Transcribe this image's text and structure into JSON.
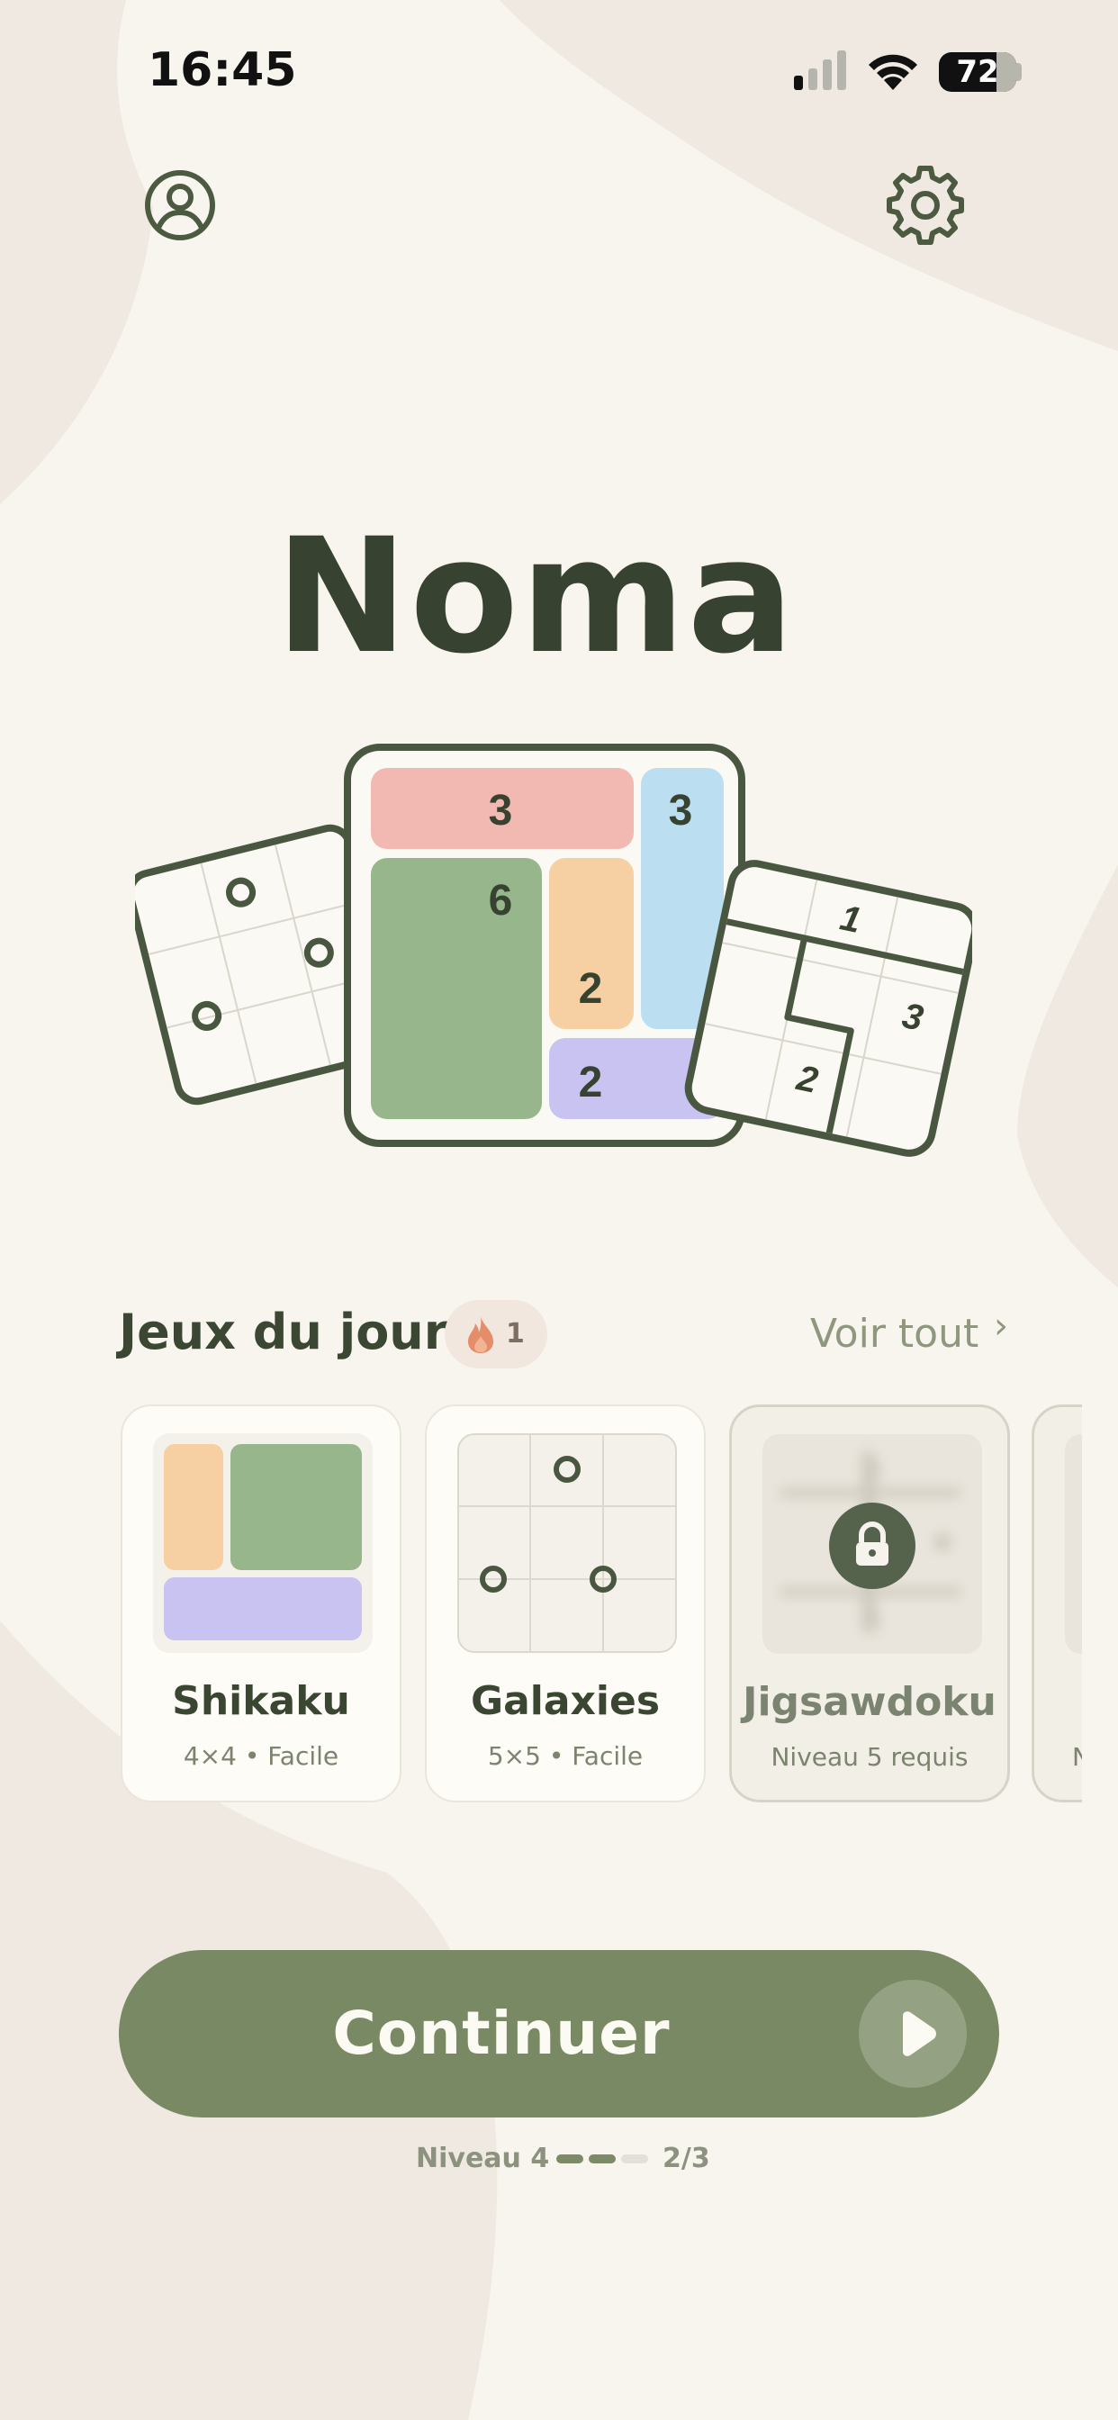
{
  "status_bar": {
    "time": "16:45",
    "battery": "72",
    "icons": [
      "cellular-signal-icon",
      "wifi-icon",
      "battery-icon"
    ]
  },
  "header": {
    "profile_icon": "user-circle-icon",
    "settings_icon": "gear-icon"
  },
  "app": {
    "title": "Noma"
  },
  "hero": {
    "center_board_numbers": [
      "3",
      "3",
      "6",
      "2",
      "2"
    ],
    "right_board_numbers": [
      "1",
      "3",
      "2"
    ]
  },
  "daily": {
    "title": "Jeux du jour",
    "streak_icon": "flame-icon",
    "streak_count": "1",
    "see_all": "Voir tout",
    "see_all_icon": "chevron-right-icon",
    "cards": [
      {
        "title": "Shikaku",
        "subtitle": "4×4 • Facile",
        "locked": false
      },
      {
        "title": "Galaxies",
        "subtitle": "5×5 • Facile",
        "locked": false
      },
      {
        "title": "Jigsawdoku",
        "subtitle": "Niveau 5 requis",
        "locked": true,
        "lock_icon": "lock-icon"
      },
      {
        "title": "",
        "subtitle": "N",
        "locked": true
      }
    ]
  },
  "continue": {
    "label": "Continuer",
    "icon": "play-icon",
    "level": "Niveau 4",
    "progress_fraction": 0.667,
    "progress_text": "2/3"
  },
  "colors": {
    "background": "#f7f5ee",
    "accent_green": "#798964",
    "dark_text": "#374230",
    "block_red": "#f2b9b3",
    "block_blue": "#bbdff1",
    "block_green": "#97b68b",
    "block_orange": "#f6d0a2",
    "block_purple": "#c8c3f1"
  }
}
